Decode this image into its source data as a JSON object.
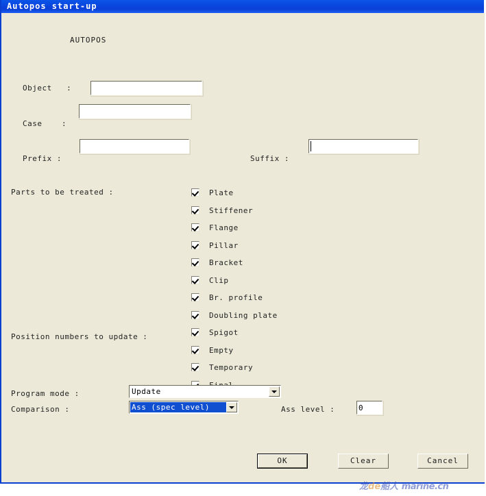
{
  "window": {
    "title": "Autopos start-up",
    "heading": "AUTOPOS"
  },
  "fields": {
    "object": {
      "label": "Object   :",
      "value": ""
    },
    "case": {
      "label": "Case    :",
      "value": ""
    },
    "prefix": {
      "label": "Prefix :",
      "value": ""
    },
    "suffix": {
      "label": "Suffix :",
      "value": ""
    },
    "ass_level": {
      "label": "Ass level :",
      "value": "0"
    }
  },
  "groups": {
    "parts_label": "Parts to be treated :",
    "position_label": "Position numbers to update :"
  },
  "checkboxes": [
    {
      "label": "Plate",
      "checked": true
    },
    {
      "label": "Stiffener",
      "checked": true
    },
    {
      "label": "Flange",
      "checked": true
    },
    {
      "label": "Pillar",
      "checked": true
    },
    {
      "label": "Bracket",
      "checked": true
    },
    {
      "label": "Clip",
      "checked": true
    },
    {
      "label": "Br. profile",
      "checked": true
    },
    {
      "label": "Doubling plate",
      "checked": true
    },
    {
      "label": "Spigot",
      "checked": true
    },
    {
      "label": "Empty",
      "checked": true
    },
    {
      "label": "Temporary",
      "checked": true
    },
    {
      "label": "Final",
      "checked": true
    }
  ],
  "combos": {
    "program_mode": {
      "label": "Program mode :",
      "value": "Update"
    },
    "comparison": {
      "label": "Comparison :",
      "value": "Ass (spec level)"
    }
  },
  "buttons": {
    "ok": "OK",
    "clear": "Clear",
    "cancel": "Cancel"
  },
  "watermark": {
    "part1": "龙",
    "part2": "de",
    "part3": "船人",
    "part4": "marine.cn"
  },
  "colors": {
    "titlebar": "#0b49e0",
    "face": "#ece9d8",
    "selection": "#1050d0",
    "field": "#ffffff"
  }
}
